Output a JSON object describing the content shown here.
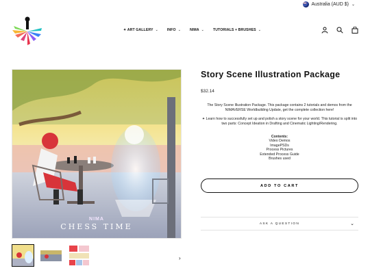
{
  "topbar": {
    "currency_label": "Australia (AUD $)",
    "flag_icon": "australia-flag-icon",
    "chevron_icon": "chevron-down-icon"
  },
  "header": {
    "logo_icon": "nimaverse-logo-icon",
    "nav": [
      {
        "label": "✦ ART GALLERY",
        "icon": "chevron-down-icon"
      },
      {
        "label": "INFO",
        "icon": "chevron-down-icon"
      },
      {
        "label": "NIMA",
        "icon": "chevron-down-icon"
      },
      {
        "label": "TUTORIALS + BRUSHES",
        "icon": "chevron-down-icon"
      }
    ],
    "icons": [
      "user-icon",
      "search-icon",
      "bag-icon"
    ]
  },
  "product": {
    "title": "Story Scene Illustration Package",
    "price": "$32.14",
    "description": "The Story Scene Illustration Package. This package contains 2 tutorials and demos from the NIMAVERSE Worldbuilding Update, get the complete collection here!",
    "description2": "✦ Learn how to successfully set up and polish a story scene for your world. This tutorial is split into two parts: Concept Ideation in Drafting and Cinematic Lighting/Rendering.",
    "contents_heading": "Contents:",
    "contents": [
      "Video Demos",
      "ImagePSDs",
      "Process Pictures",
      "Extended Process Guide",
      "Brushes used"
    ],
    "add_to_cart": "ADD TO CART",
    "ask_question": "ASK A QUESTION",
    "image_caption": "CHESS TIME",
    "image_mark": "NIMA"
  },
  "gallery": {
    "thumbnail_count": 3,
    "next_arrow": "›",
    "next_icon": "chevron-right-icon"
  },
  "colors": {
    "text": "#111111",
    "border": "#e2e2e2",
    "accent_red": "#d8343a"
  }
}
